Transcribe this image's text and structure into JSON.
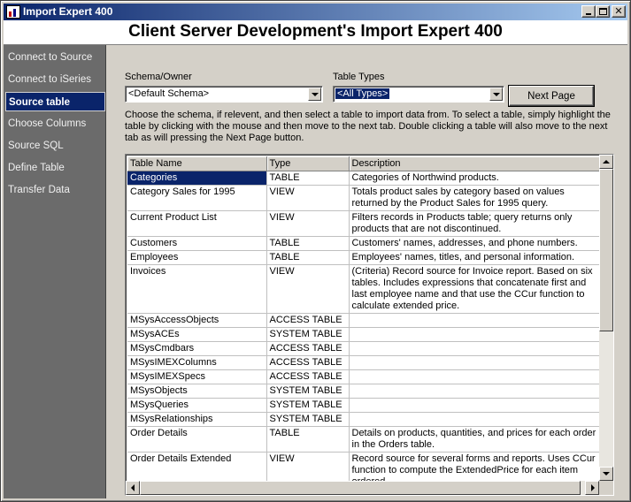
{
  "window": {
    "title": "Import Expert 400",
    "header": "Client Server Development's Import Expert 400"
  },
  "sidebar": {
    "items": [
      {
        "label": "Connect to Source"
      },
      {
        "label": "Connect to iSeries"
      },
      {
        "label": "Source table"
      },
      {
        "label": "Choose Columns"
      },
      {
        "label": "Source SQL"
      },
      {
        "label": "Define Table"
      },
      {
        "label": "Transfer Data"
      }
    ],
    "active_index": 2
  },
  "form": {
    "schema_label": "Schema/Owner",
    "schema_value": "<Default Schema>",
    "types_label": "Table Types",
    "types_value": "<All Types>",
    "next_button": "Next Page",
    "help_text": "Choose the schema, if relevent, and then select a table to import data from. To select a table, simply highlight the table by clicking with the mouse and then move to the next tab. Double clicking a table will also move to the next tab as will pressing the Next Page button."
  },
  "table": {
    "columns": [
      "Table Name",
      "Type",
      "Description"
    ],
    "rows": [
      [
        "Categories",
        "TABLE",
        "Categories of Northwind products."
      ],
      [
        "Category Sales for 1995",
        "VIEW",
        "Totals product sales by category based on values returned by the Product Sales for 1995 query."
      ],
      [
        "Current Product List",
        "VIEW",
        "Filters records in Products table; query returns only products that are not discontinued."
      ],
      [
        "Customers",
        "TABLE",
        "Customers' names, addresses, and phone numbers."
      ],
      [
        "Employees",
        "TABLE",
        "Employees' names, titles, and personal information."
      ],
      [
        "Invoices",
        "VIEW",
        "(Criteria) Record source for Invoice report. Based on six tables. Includes expressions that concatenate first and last employee name and that use the CCur function to calculate extended price."
      ],
      [
        "MSysAccessObjects",
        "ACCESS TABLE",
        ""
      ],
      [
        "MSysACEs",
        "SYSTEM TABLE",
        ""
      ],
      [
        "MSysCmdbars",
        "ACCESS TABLE",
        ""
      ],
      [
        "MSysIMEXColumns",
        "ACCESS TABLE",
        ""
      ],
      [
        "MSysIMEXSpecs",
        "ACCESS TABLE",
        ""
      ],
      [
        "MSysObjects",
        "SYSTEM TABLE",
        ""
      ],
      [
        "MSysQueries",
        "SYSTEM TABLE",
        ""
      ],
      [
        "MSysRelationships",
        "SYSTEM TABLE",
        ""
      ],
      [
        "Order Details",
        "TABLE",
        "Details on products, quantities, and prices for each order in the Orders table."
      ],
      [
        "Order Details Extended",
        "VIEW",
        "Record source for several forms and reports. Uses CCur function to compute the ExtendedPrice for each item ordered."
      ]
    ],
    "selected_row": 0
  },
  "colors": {
    "selection": "#0a246a",
    "sidebar_bg": "#6b6b6b",
    "face": "#d4d0c8"
  }
}
